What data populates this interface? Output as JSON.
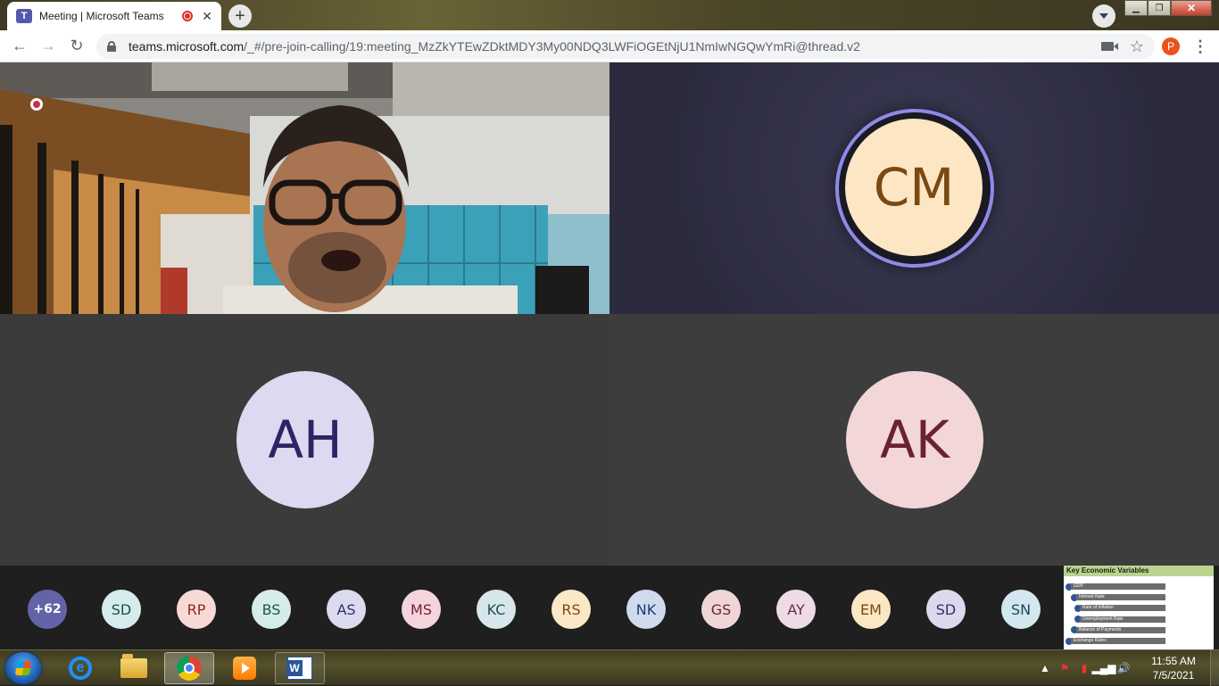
{
  "browser": {
    "tab": {
      "title": "Meeting | Microsoft Teams"
    },
    "url": {
      "host": "teams.microsoft.com",
      "path": "/_#/pre-join-calling/19:meeting_MzZkYTEwZDktMDY3My00NDQ3LWFiOGEtNjU1NmIwNGQwYmRi@thread.v2"
    },
    "profile_initial": "P",
    "icons": {
      "back": "arrow-left-icon",
      "forward": "arrow-right-icon",
      "reload": "reload-icon",
      "lock": "lock-icon",
      "camera": "camera-icon",
      "bookmark": "star-icon",
      "menu": "kebab-menu-icon"
    }
  },
  "meeting": {
    "tiles": {
      "video_participant": {
        "type": "video",
        "recording_indicator": true
      },
      "cm": {
        "initials": "CM",
        "speaking": true,
        "avatar_bg": "#fde6c4",
        "avatar_fg": "#7a4a12",
        "ring": "#8f8ae6"
      },
      "ah": {
        "initials": "AH",
        "avatar_bg": "#dcd9f0",
        "avatar_fg": "#2c2464"
      },
      "ak": {
        "initials": "AK",
        "avatar_bg": "#f3d6d8",
        "avatar_fg": "#6b2230"
      }
    },
    "roster": {
      "overflow_label": "+62",
      "participants": [
        {
          "initials": "SD",
          "bg": "#d6ecec",
          "fg": "#1d4f52"
        },
        {
          "initials": "RP",
          "bg": "#f7dad6",
          "fg": "#8a2a1c"
        },
        {
          "initials": "BS",
          "bg": "#d5ece7",
          "fg": "#1f5549"
        },
        {
          "initials": "AS",
          "bg": "#dcdaee",
          "fg": "#34306a"
        },
        {
          "initials": "MS",
          "bg": "#f5d5dd",
          "fg": "#7a2036"
        },
        {
          "initials": "KC",
          "bg": "#d6e6ea",
          "fg": "#1f4a57"
        },
        {
          "initials": "RS",
          "bg": "#fbe8c8",
          "fg": "#7a4a12"
        },
        {
          "initials": "NK",
          "bg": "#cfdaee",
          "fg": "#1d3a72"
        },
        {
          "initials": "GS",
          "bg": "#eed6d6",
          "fg": "#6e2626"
        },
        {
          "initials": "AY",
          "bg": "#eedbe6",
          "fg": "#6a2a52"
        },
        {
          "initials": "EM",
          "bg": "#fbe7c4",
          "fg": "#7a4a12"
        },
        {
          "initials": "SD",
          "bg": "#dcd9ee",
          "fg": "#34306a"
        },
        {
          "initials": "SN",
          "bg": "#d3e7ee",
          "fg": "#1e4a5a"
        }
      ]
    },
    "shared_content": {
      "title": "Key Economic Variables",
      "rows": [
        "GDP",
        "Interest Rate",
        "Rate of Inflation",
        "Unemployment Rate",
        "Balance of Payments",
        "Exchange Rates"
      ]
    }
  },
  "taskbar": {
    "apps": [
      "internet-explorer-icon",
      "file-explorer-icon",
      "chrome-icon",
      "media-player-icon",
      "word-icon"
    ],
    "clock": {
      "time": "11:55 AM",
      "date": "7/5/2021"
    }
  }
}
